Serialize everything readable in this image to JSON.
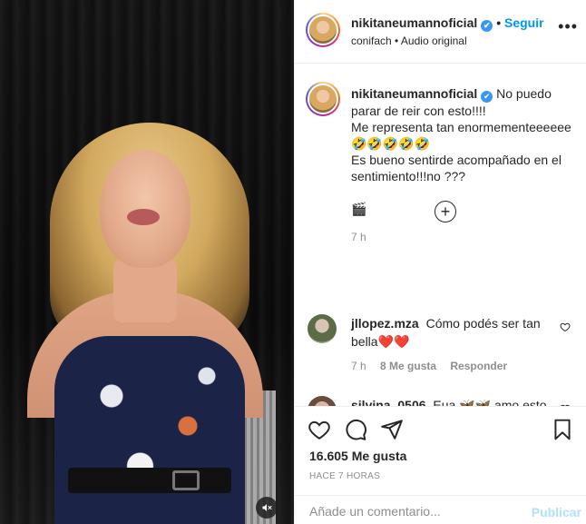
{
  "post": {
    "author": "nikitaneumannoficial",
    "follow_label": "Seguir",
    "more_label": "•••",
    "audio_author": "conifach",
    "audio_separator": "•",
    "audio_label": "Audio original"
  },
  "caption": {
    "author": "nikitaneumannoficial",
    "text": "No puedo parar de reir con esto!!!!\nMe representa tan enormementeeeeee🤣🤣🤣🤣🤣\nEs bueno sentirde acompañado en el sentimiento!!!no ???\n\n🎬",
    "time": "7 h"
  },
  "comments": [
    {
      "username": "jllopez.mza",
      "text": "Cómo podés ser tan bella❤️❤️",
      "time": "7 h",
      "likes": "8 Me gusta",
      "reply_label": "Responder"
    },
    {
      "username": "silvina_0506",
      "text": "Eua 🦋🦋 amo esto"
    }
  ],
  "stats": {
    "likes": "16.605 Me gusta",
    "posted": "HACE 7 HORAS"
  },
  "composer": {
    "placeholder": "Añade un comentario...",
    "publish_label": "Publicar"
  },
  "colors": {
    "accent": "#0095f6",
    "verified": "#3897f0",
    "muted": "#8e8e8e",
    "publish_disabled": "#b2dffc",
    "heart": "#e0245e"
  },
  "icons": {
    "mute": "speaker-muted-icon",
    "like": "heart-outline-icon",
    "comment": "speech-bubble-icon",
    "share": "paper-plane-icon",
    "save": "bookmark-icon",
    "load_more": "plus-circle-icon"
  }
}
